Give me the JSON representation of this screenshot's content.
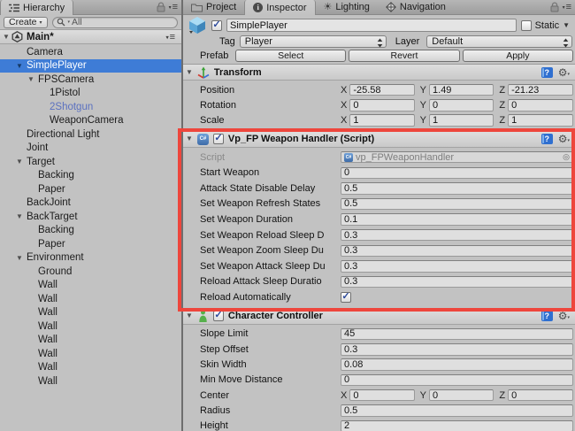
{
  "axes": [
    "X",
    "Y",
    "Z"
  ],
  "icons": {
    "check": "✓",
    "gear": "⚙",
    "foldout_open": "▼",
    "dropdown_arrow": "▼",
    "menu_triangle": "▾",
    "menu_lines": "≡",
    "target": "◎",
    "create_arrow": "▾"
  },
  "annotation": {
    "highlight_color": "#ee463c"
  },
  "hierarchy": {
    "tab_label": "Hierarchy",
    "toolbar": {
      "create_label": "Create",
      "search_text": "All"
    },
    "scene_label": "Main*",
    "items": [
      {
        "label": "Camera",
        "indent": 1
      },
      {
        "label": "SimplePlayer",
        "indent": 1,
        "foldout": true,
        "selected": true
      },
      {
        "label": "FPSCamera",
        "indent": 2,
        "foldout": true
      },
      {
        "label": "1Pistol",
        "indent": 3
      },
      {
        "label": "2Shotgun",
        "indent": 3,
        "prefab": true
      },
      {
        "label": "WeaponCamera",
        "indent": 3
      },
      {
        "label": "Directional Light",
        "indent": 1
      },
      {
        "label": "Joint",
        "indent": 1
      },
      {
        "label": "Target",
        "indent": 1,
        "foldout": true
      },
      {
        "label": "Backing",
        "indent": 2
      },
      {
        "label": "Paper",
        "indent": 2
      },
      {
        "label": "BackJoint",
        "indent": 1
      },
      {
        "label": "BackTarget",
        "indent": 1,
        "foldout": true
      },
      {
        "label": "Backing",
        "indent": 2
      },
      {
        "label": "Paper",
        "indent": 2
      },
      {
        "label": "Environment",
        "indent": 1,
        "foldout": true
      },
      {
        "label": "Ground",
        "indent": 2
      },
      {
        "label": "Wall",
        "indent": 2
      },
      {
        "label": "Wall",
        "indent": 2
      },
      {
        "label": "Wall",
        "indent": 2
      },
      {
        "label": "Wall",
        "indent": 2
      },
      {
        "label": "Wall",
        "indent": 2
      },
      {
        "label": "Wall",
        "indent": 2
      },
      {
        "label": "Wall",
        "indent": 2
      },
      {
        "label": "Wall",
        "indent": 2
      }
    ]
  },
  "inspector": {
    "tabs": [
      {
        "label": "Project",
        "icon": "folder"
      },
      {
        "label": "Inspector",
        "icon": "info",
        "active": true
      },
      {
        "label": "Lighting",
        "icon": "lighting"
      },
      {
        "label": "Navigation",
        "icon": "navigation"
      }
    ],
    "header": {
      "name": "SimplePlayer",
      "static_label": "Static",
      "tag_label": "Tag",
      "tag_value": "Player",
      "layer_label": "Layer",
      "layer_value": "Default",
      "prefab_label": "Prefab",
      "prefab_buttons": [
        "Select",
        "Revert",
        "Apply"
      ]
    },
    "components": [
      {
        "title": "Transform",
        "icon": "transform",
        "rows": [
          {
            "type": "vec3",
            "label": "Position",
            "x": "-25.58",
            "y": "1.49",
            "z": "-21.23"
          },
          {
            "type": "vec3",
            "label": "Rotation",
            "x": "0",
            "y": "0",
            "z": "0"
          },
          {
            "type": "vec3",
            "label": "Scale",
            "x": "1",
            "y": "1",
            "z": "1"
          }
        ]
      },
      {
        "title": "Vp_FP Weapon Handler (Script)",
        "icon": "script",
        "enabled": true,
        "annotated": true,
        "rows": [
          {
            "type": "object",
            "label": "Script",
            "value": "vp_FPWeaponHandler",
            "disabled": true
          },
          {
            "type": "field",
            "label": "Start Weapon",
            "value": "0"
          },
          {
            "type": "field",
            "label": "Attack State Disable Delay",
            "value": "0.5"
          },
          {
            "type": "field",
            "label": "Set Weapon Refresh States",
            "value": "0.5"
          },
          {
            "type": "field",
            "label": "Set Weapon Duration",
            "value": "0.1"
          },
          {
            "type": "field",
            "label": "Set Weapon Reload Sleep D",
            "value": "0.3"
          },
          {
            "type": "field",
            "label": "Set Weapon Zoom Sleep Du",
            "value": "0.3"
          },
          {
            "type": "field",
            "label": "Set Weapon Attack Sleep Du",
            "value": "0.3"
          },
          {
            "type": "field",
            "label": "Reload Attack Sleep Duratio",
            "value": "0.3"
          },
          {
            "type": "check",
            "label": "Reload Automatically",
            "checked": true
          }
        ]
      },
      {
        "title": "Character Controller",
        "icon": "character",
        "enabled": true,
        "rows": [
          {
            "type": "field",
            "label": "Slope Limit",
            "value": "45"
          },
          {
            "type": "field",
            "label": "Step Offset",
            "value": "0.3"
          },
          {
            "type": "field",
            "label": "Skin Width",
            "value": "0.08"
          },
          {
            "type": "field",
            "label": "Min Move Distance",
            "value": "0"
          },
          {
            "type": "vec3",
            "label": "Center",
            "x": "0",
            "y": "0",
            "z": "0"
          },
          {
            "type": "field",
            "label": "Radius",
            "value": "0.5"
          },
          {
            "type": "field",
            "label": "Height",
            "value": "2"
          }
        ]
      }
    ]
  }
}
